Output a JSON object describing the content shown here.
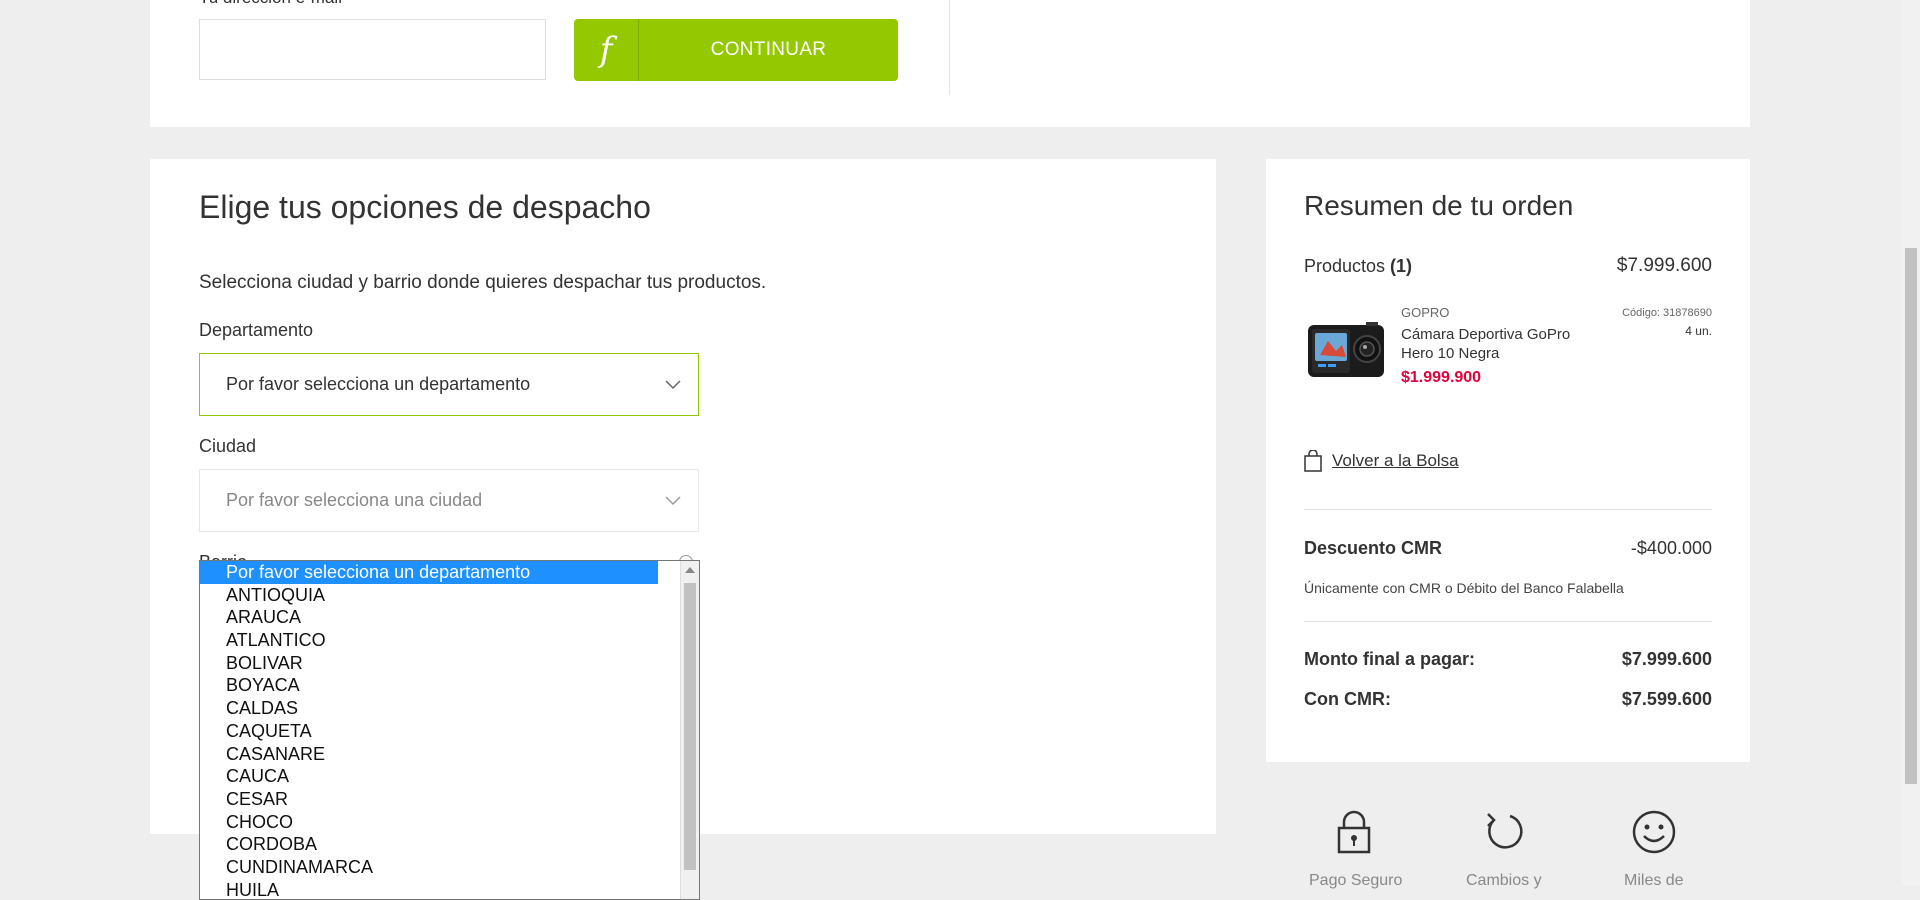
{
  "top": {
    "email_label": "Tu dirección e-mail",
    "continue_label": "CONTINUAR",
    "logo_glyph": "f"
  },
  "dispatch": {
    "title": "Elige tus opciones de despacho",
    "subtitle": "Selecciona ciudad y barrio donde quieres despachar tus productos.",
    "departamento": {
      "label": "Departamento",
      "value": "Por favor selecciona un departamento"
    },
    "ciudad": {
      "label": "Ciudad",
      "placeholder": "Por favor selecciona una ciudad"
    },
    "barrio": {
      "label": "Barrio"
    },
    "dropdown": {
      "options": [
        "Por favor selecciona un departamento",
        "ANTIOQUIA",
        "ARAUCA",
        "ATLANTICO",
        "BOLIVAR",
        "BOYACA",
        "CALDAS",
        "CAQUETA",
        "CASANARE",
        "CAUCA",
        "CESAR",
        "CHOCO",
        "CORDOBA",
        "CUNDINAMARCA",
        "HUILA"
      ]
    }
  },
  "summary": {
    "title": "Resumen de tu orden",
    "products_label": "Productos ",
    "products_count": "(1)",
    "products_total": "$7.999.600",
    "item": {
      "brand": "GOPRO",
      "name": "Cámara Deportiva GoPro Hero 10 Negra",
      "price": "$1.999.900",
      "code": "Código: 31878690",
      "qty": "4 un."
    },
    "back_label": "Volver a la Bolsa",
    "discount_label": "Descuento CMR",
    "discount_value": "-$400.000",
    "discount_note": "Únicamente con CMR o Débito del Banco Falabella",
    "final_label": "Monto final a pagar:",
    "final_value": "$7.999.600",
    "cmr_label": "Con CMR:",
    "cmr_value": "$7.599.600",
    "accent_color": "#94c800",
    "price_color": "#e4003b"
  },
  "footer": {
    "items": [
      {
        "icon": "lock-icon",
        "label": "Pago Seguro"
      },
      {
        "icon": "refresh-icon",
        "label": "Cambios y"
      },
      {
        "icon": "smile-icon",
        "label": "Miles de"
      }
    ]
  }
}
